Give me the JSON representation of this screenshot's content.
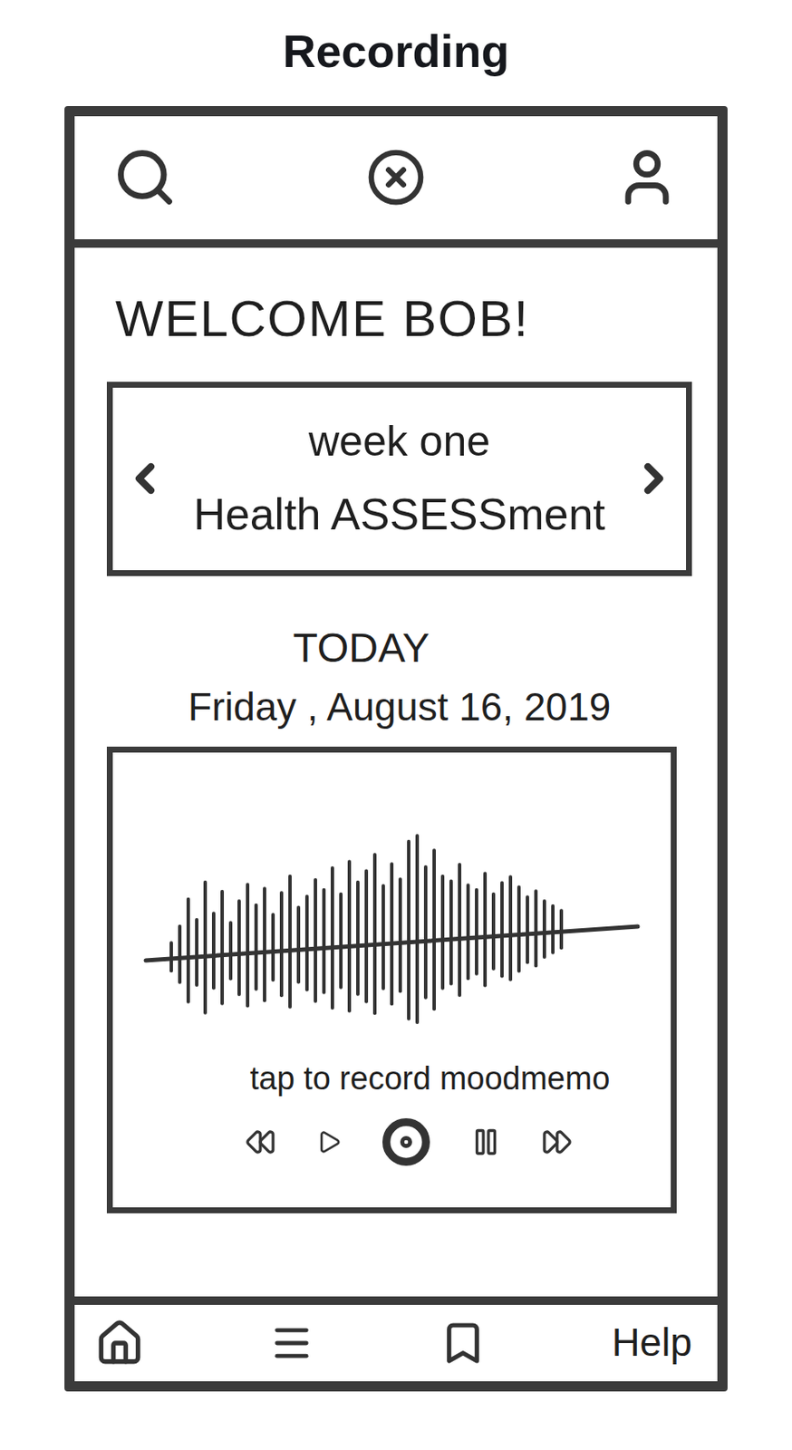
{
  "page_title": "Recording",
  "greeting": "WELCOME BOB!",
  "week_card": {
    "week": "week one",
    "title": "Health ASSESSment"
  },
  "today": {
    "label": "TODAY",
    "date": "Friday , August 16, 2019"
  },
  "recorder": {
    "prompt": "tap to record moodmemo",
    "waveform": [
      0.15,
      0.3,
      0.55,
      0.35,
      0.7,
      0.4,
      0.6,
      0.3,
      0.5,
      0.65,
      0.45,
      0.6,
      0.35,
      0.55,
      0.7,
      0.4,
      0.5,
      0.65,
      0.55,
      0.75,
      0.5,
      0.8,
      0.6,
      0.7,
      0.85,
      0.55,
      0.75,
      0.6,
      0.95,
      1.0,
      0.7,
      0.85,
      0.6,
      0.55,
      0.7,
      0.5,
      0.45,
      0.6,
      0.4,
      0.5,
      0.55,
      0.45,
      0.35,
      0.4,
      0.3,
      0.25,
      0.2
    ]
  },
  "bottom_nav": {
    "help": "Help"
  }
}
